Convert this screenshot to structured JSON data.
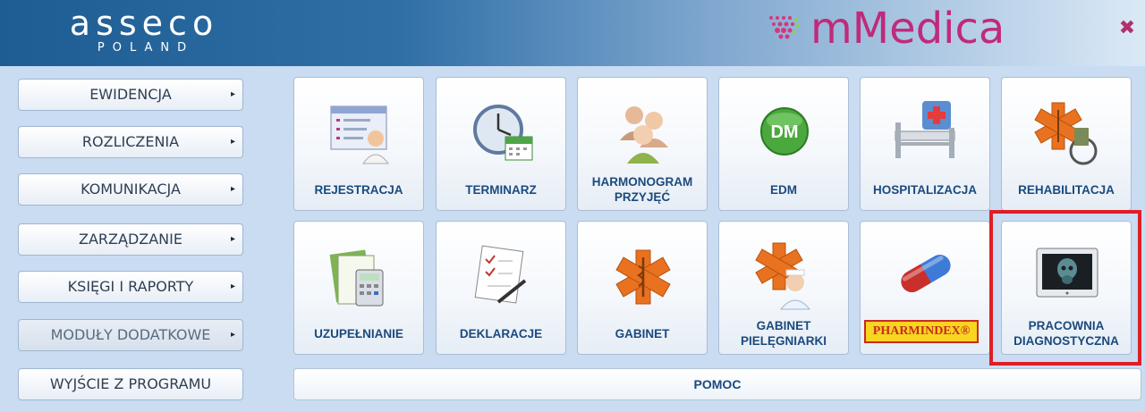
{
  "header": {
    "brand_left": "asseco",
    "brand_left_sub": "POLAND",
    "brand_right": "mMedica",
    "close_icon": "close-icon"
  },
  "menu": {
    "arrow": "▸",
    "items": [
      {
        "label": "EWIDENCJA"
      },
      {
        "label": "ROZLICZENIA"
      },
      {
        "label": "KOMUNIKACJA"
      },
      {
        "label": "ZARZĄDZANIE"
      },
      {
        "label": "KSIĘGI I RAPORTY"
      },
      {
        "label": "MODUŁY DODATKOWE"
      },
      {
        "label": "WYJŚCIE Z PROGRAMU"
      }
    ]
  },
  "tiles": [
    {
      "label": "REJESTRACJA",
      "icon": "registration-form-icon"
    },
    {
      "label": "TERMINARZ",
      "icon": "clock-calendar-icon"
    },
    {
      "label": "HARMONOGRAM\nPRZYJĘĆ",
      "icon": "people-group-icon"
    },
    {
      "label": "EDM",
      "icon": "edm-icon"
    },
    {
      "label": "HOSPITALIZACJA",
      "icon": "hospital-bed-icon"
    },
    {
      "label": "REHABILITACJA",
      "icon": "wheelchair-icon"
    },
    {
      "label": "UZUPEŁNIANIE",
      "icon": "calculator-document-icon"
    },
    {
      "label": "DEKLARACJE",
      "icon": "signed-document-icon"
    },
    {
      "label": "GABINET",
      "icon": "star-of-life-icon"
    },
    {
      "label": "GABINET\nPIELĘGNIARKI",
      "icon": "nurse-icon"
    },
    {
      "label": "PHARMINDEX®",
      "icon": "pills-icon"
    },
    {
      "label": "PRACOWNIA\nDIAGNOSTYCZNA",
      "icon": "xray-monitor-icon"
    }
  ],
  "pomoc": "POMOC",
  "colors": {
    "header_blue": "#1e5d93",
    "brand_magenta": "#c02a7b",
    "label_blue": "#1b4a7e",
    "highlight_red": "#e01e26",
    "background": "#c9dcf2"
  }
}
